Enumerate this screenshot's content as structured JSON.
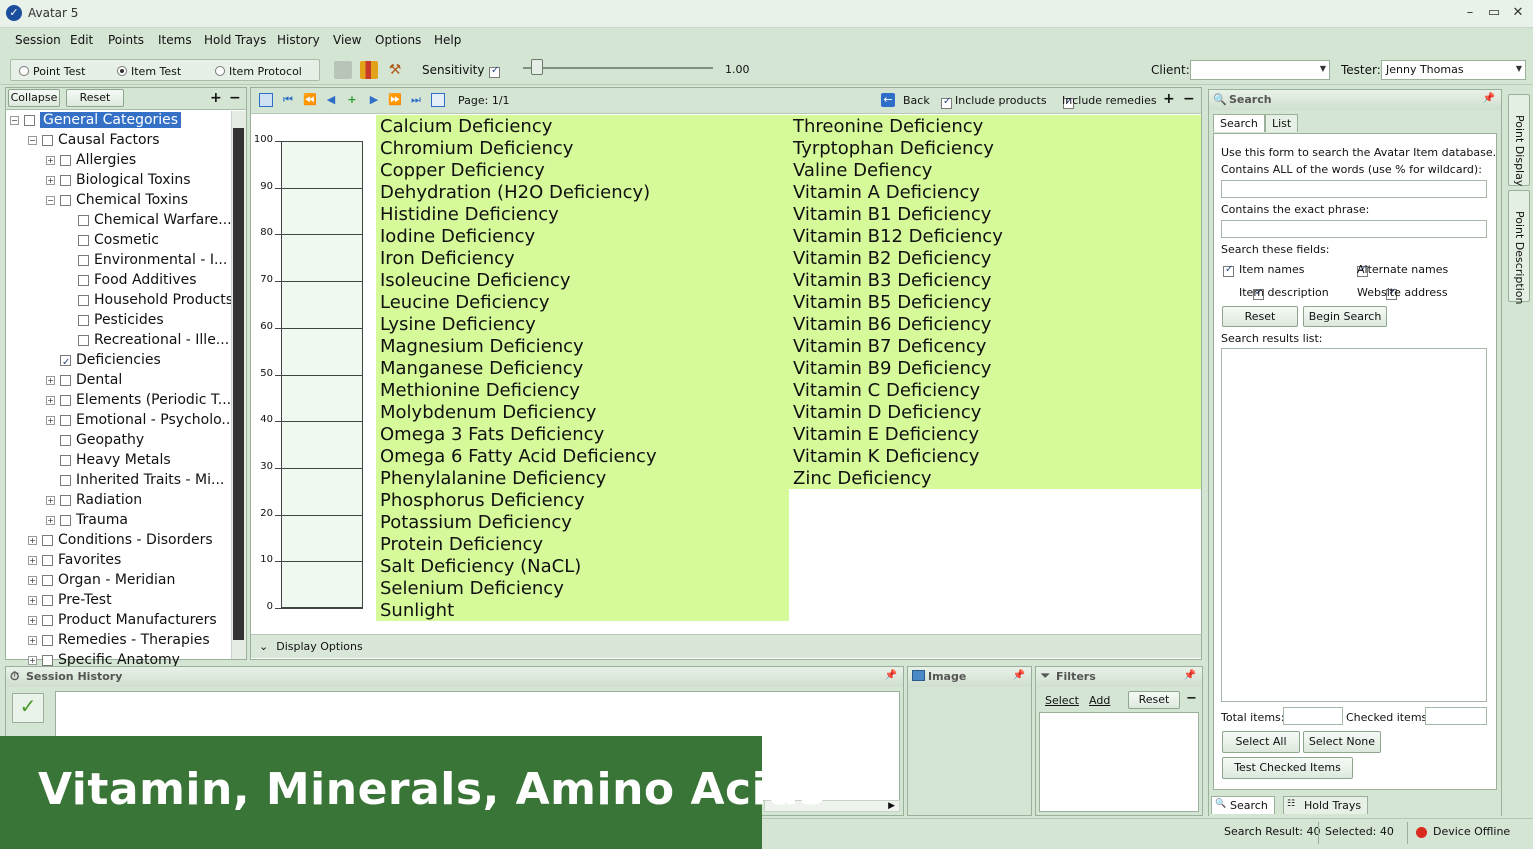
{
  "window": {
    "title": "Avatar 5",
    "minimize": "–",
    "maximize": "▭",
    "close": "✕"
  },
  "menu": [
    "Session",
    "Edit",
    "Points",
    "Items",
    "Hold Trays",
    "History",
    "View",
    "Options",
    "Help"
  ],
  "toolbar": {
    "modes": [
      {
        "label": "Point Test",
        "selected": false
      },
      {
        "label": "Item Test",
        "selected": true
      },
      {
        "label": "Item Protocol",
        "selected": false
      }
    ],
    "sensitivity_label": "Sensitivity",
    "sensitivity_checked": true,
    "sensitivity_value": "1.00",
    "client_label": "Client:",
    "client_value": "",
    "tester_label": "Tester:",
    "tester_value": "Jenny Thomas"
  },
  "tree": {
    "collapse_label": "Collapse",
    "reset_label": "Reset",
    "plus": "+",
    "minus": "−",
    "rows": [
      {
        "label": "General Categories",
        "level": 0,
        "selected": true,
        "checked": false,
        "expander": "−"
      },
      {
        "label": "Causal Factors",
        "level": 1,
        "checked": false,
        "expander": "−"
      },
      {
        "label": "Allergies",
        "level": 2,
        "checked": false,
        "expander": "+"
      },
      {
        "label": "Biological Toxins",
        "level": 2,
        "checked": false,
        "expander": "+"
      },
      {
        "label": "Chemical Toxins",
        "level": 2,
        "checked": false,
        "expander": "−"
      },
      {
        "label": "Chemical Warfare...",
        "level": 3,
        "checked": false,
        "expander": ""
      },
      {
        "label": "Cosmetic",
        "level": 3,
        "checked": false,
        "expander": ""
      },
      {
        "label": "Environmental - I...",
        "level": 3,
        "checked": false,
        "expander": ""
      },
      {
        "label": "Food Additives",
        "level": 3,
        "checked": false,
        "expander": ""
      },
      {
        "label": "Household Products",
        "level": 3,
        "checked": false,
        "expander": ""
      },
      {
        "label": "Pesticides",
        "level": 3,
        "checked": false,
        "expander": ""
      },
      {
        "label": "Recreational - Ille...",
        "level": 3,
        "checked": false,
        "expander": ""
      },
      {
        "label": "Deficiencies",
        "level": 2,
        "checked": true,
        "expander": ""
      },
      {
        "label": "Dental",
        "level": 2,
        "checked": false,
        "expander": "+"
      },
      {
        "label": "Elements (Periodic T...",
        "level": 2,
        "checked": false,
        "expander": "+"
      },
      {
        "label": "Emotional - Psycholo...",
        "level": 2,
        "checked": false,
        "expander": "+"
      },
      {
        "label": "Geopathy",
        "level": 2,
        "checked": false,
        "expander": ""
      },
      {
        "label": "Heavy Metals",
        "level": 2,
        "checked": false,
        "expander": ""
      },
      {
        "label": "Inherited Traits - Mi...",
        "level": 2,
        "checked": false,
        "expander": ""
      },
      {
        "label": "Radiation",
        "level": 2,
        "checked": false,
        "expander": "+"
      },
      {
        "label": "Trauma",
        "level": 2,
        "checked": false,
        "expander": "+"
      },
      {
        "label": "Conditions - Disorders",
        "level": 1,
        "checked": false,
        "expander": "+"
      },
      {
        "label": "Favorites",
        "level": 1,
        "checked": false,
        "expander": "+"
      },
      {
        "label": "Organ - Meridian",
        "level": 1,
        "checked": false,
        "expander": "+"
      },
      {
        "label": "Pre-Test",
        "level": 1,
        "checked": false,
        "expander": "+"
      },
      {
        "label": "Product Manufacturers",
        "level": 1,
        "checked": false,
        "expander": "+"
      },
      {
        "label": "Remedies - Therapies",
        "level": 1,
        "checked": false,
        "expander": "+"
      },
      {
        "label": "Specific Anatomy",
        "level": 1,
        "checked": false,
        "expander": "+"
      }
    ]
  },
  "center": {
    "page_label": "Page: 1/1",
    "back_label": "Back",
    "include_products_label": "Include products",
    "include_products_checked": true,
    "include_remedies_label": "Include remedies",
    "include_remedies_checked": true,
    "plus": "+",
    "minus": "−",
    "display_options_label": "Display Options",
    "scale_ticks": [
      "100",
      "90",
      "80",
      "70",
      "60",
      "50",
      "40",
      "30",
      "20",
      "10",
      "0"
    ],
    "items_col1": [
      "Calcium Deficiency",
      "Chromium Deficiency",
      "Copper Deficiency",
      "Dehydration (H2O Deficiency)",
      "Histidine Deficiency",
      "Iodine Deficiency",
      "Iron Deficiency",
      "Isoleucine Deficiency",
      "Leucine   Deficiency",
      "Lysine Deficiency",
      "Magnesium Deficiency",
      "Manganese Deficiency",
      "Methionine Deficiency",
      "Molybdenum Deficiency",
      "Omega 3 Fats Deficiency",
      "Omega 6 Fatty Acid Deficiency",
      "Phenylalanine Deficiency",
      "Phosphorus Deficiency",
      "Potassium Deficiency",
      "Protein Deficiency",
      "Salt Deficiency (NaCL)",
      "Selenium Deficiency",
      "Sunlight"
    ],
    "items_col2": [
      "Threonine Deficiency",
      "Tyrptophan Deficiency",
      "Valine Defiency",
      "Vitamin A Deficiency",
      "Vitamin B1 Deficiency",
      "Vitamin B12 Deficiency",
      "Vitamin B2 Deficiency",
      "Vitamin B3 Deficiency",
      "Vitamin B5 Deficiency",
      "Vitamin B6 Deficiency",
      "Vitamin B7 Deficency",
      "Vitamin B9 Deficiency",
      "Vitamin C Deficiency",
      "Vitamin D Deficiency",
      "Vitamin E Deficiency",
      "Vitamin K Deficiency",
      "Zinc Deficiency"
    ]
  },
  "search_panel": {
    "title": "Search",
    "tab_search": "Search",
    "tab_list": "List",
    "intro": "Use this form to search the Avatar Item database.",
    "all_words_label": "Contains ALL of the words (use % for wildcard):",
    "all_words_value": "",
    "exact_phrase_label": "Contains the exact phrase:",
    "exact_phrase_value": "",
    "fields_label": "Search these fields:",
    "field_item_names": "Item names",
    "field_alternate_names": "Alternate names",
    "field_item_description": "Item description",
    "field_website_address": "Website address",
    "reset_label": "Reset",
    "begin_search_label": "Begin Search",
    "results_label": "Search results list:",
    "total_items_label": "Total items:",
    "total_items_value": "",
    "checked_items_label": "Checked items:",
    "checked_items_value": "",
    "select_all_label": "Select All",
    "select_none_label": "Select None",
    "test_checked_label": "Test Checked Items",
    "bottom_tab_search": "Search",
    "bottom_tab_hold_trays": "Hold Trays"
  },
  "side_tabs": {
    "point_display": "Point Display",
    "point_description": "Point Description"
  },
  "session_history": {
    "title": "Session History"
  },
  "image_pane": {
    "title": "Image"
  },
  "filters": {
    "title": "Filters",
    "select": "Select",
    "add": "Add",
    "reset": "Reset",
    "minus": "−"
  },
  "status": {
    "search_result": "Search Result: 40",
    "selected": "Selected: 40",
    "device": "Device Offline",
    "device_color": "#d92b1e"
  },
  "banner": {
    "text": "Vitamin, Minerals, Amino Acids",
    "color": "#3a7538"
  }
}
